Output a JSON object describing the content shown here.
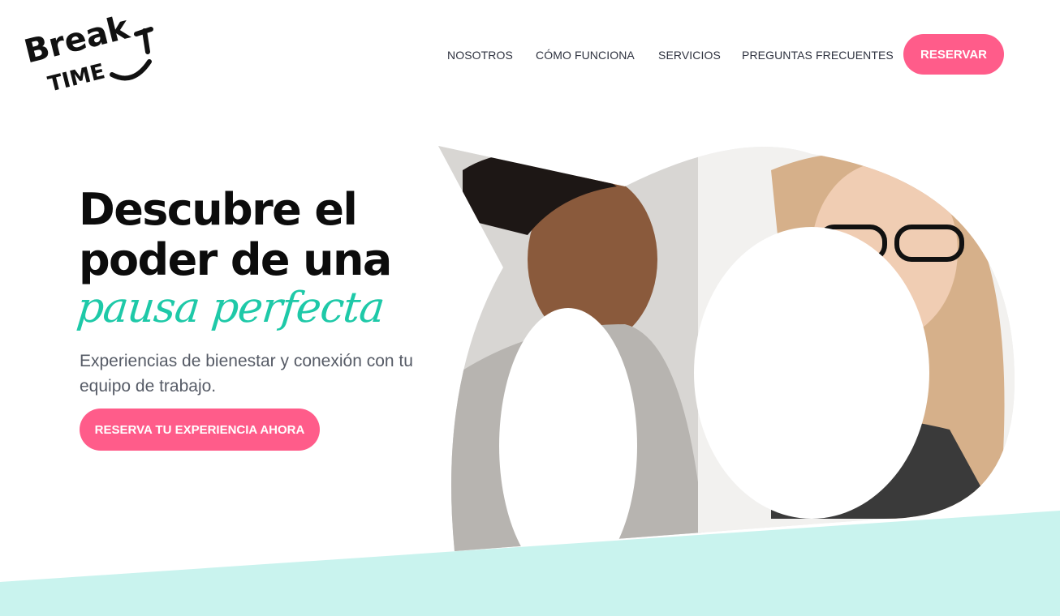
{
  "brand": {
    "logo_top": "Break",
    "logo_bottom": "TIME"
  },
  "nav": {
    "items": [
      {
        "label": "NOSOTROS"
      },
      {
        "label": "CÓMO FUNCIONA"
      },
      {
        "label": "SERVICIOS"
      },
      {
        "label": "PREGUNTAS FRECUENTES"
      }
    ],
    "cta_label": "RESERVAR"
  },
  "hero": {
    "title_line1": "Descubre el",
    "title_line2": "poder de una",
    "script_text": "pausa perfecta",
    "subtitle": "Experiencias de bienestar y conexión con tu equipo de trabajo.",
    "cta_label": "RESERVA TU EXPERIENCIA AHORA"
  },
  "colors": {
    "accent_pink": "#ff5c8a",
    "accent_teal": "#1ec9a8",
    "band_teal": "#c9f3ee",
    "text_dark": "#0c0c0c",
    "text_muted": "#565b66"
  }
}
